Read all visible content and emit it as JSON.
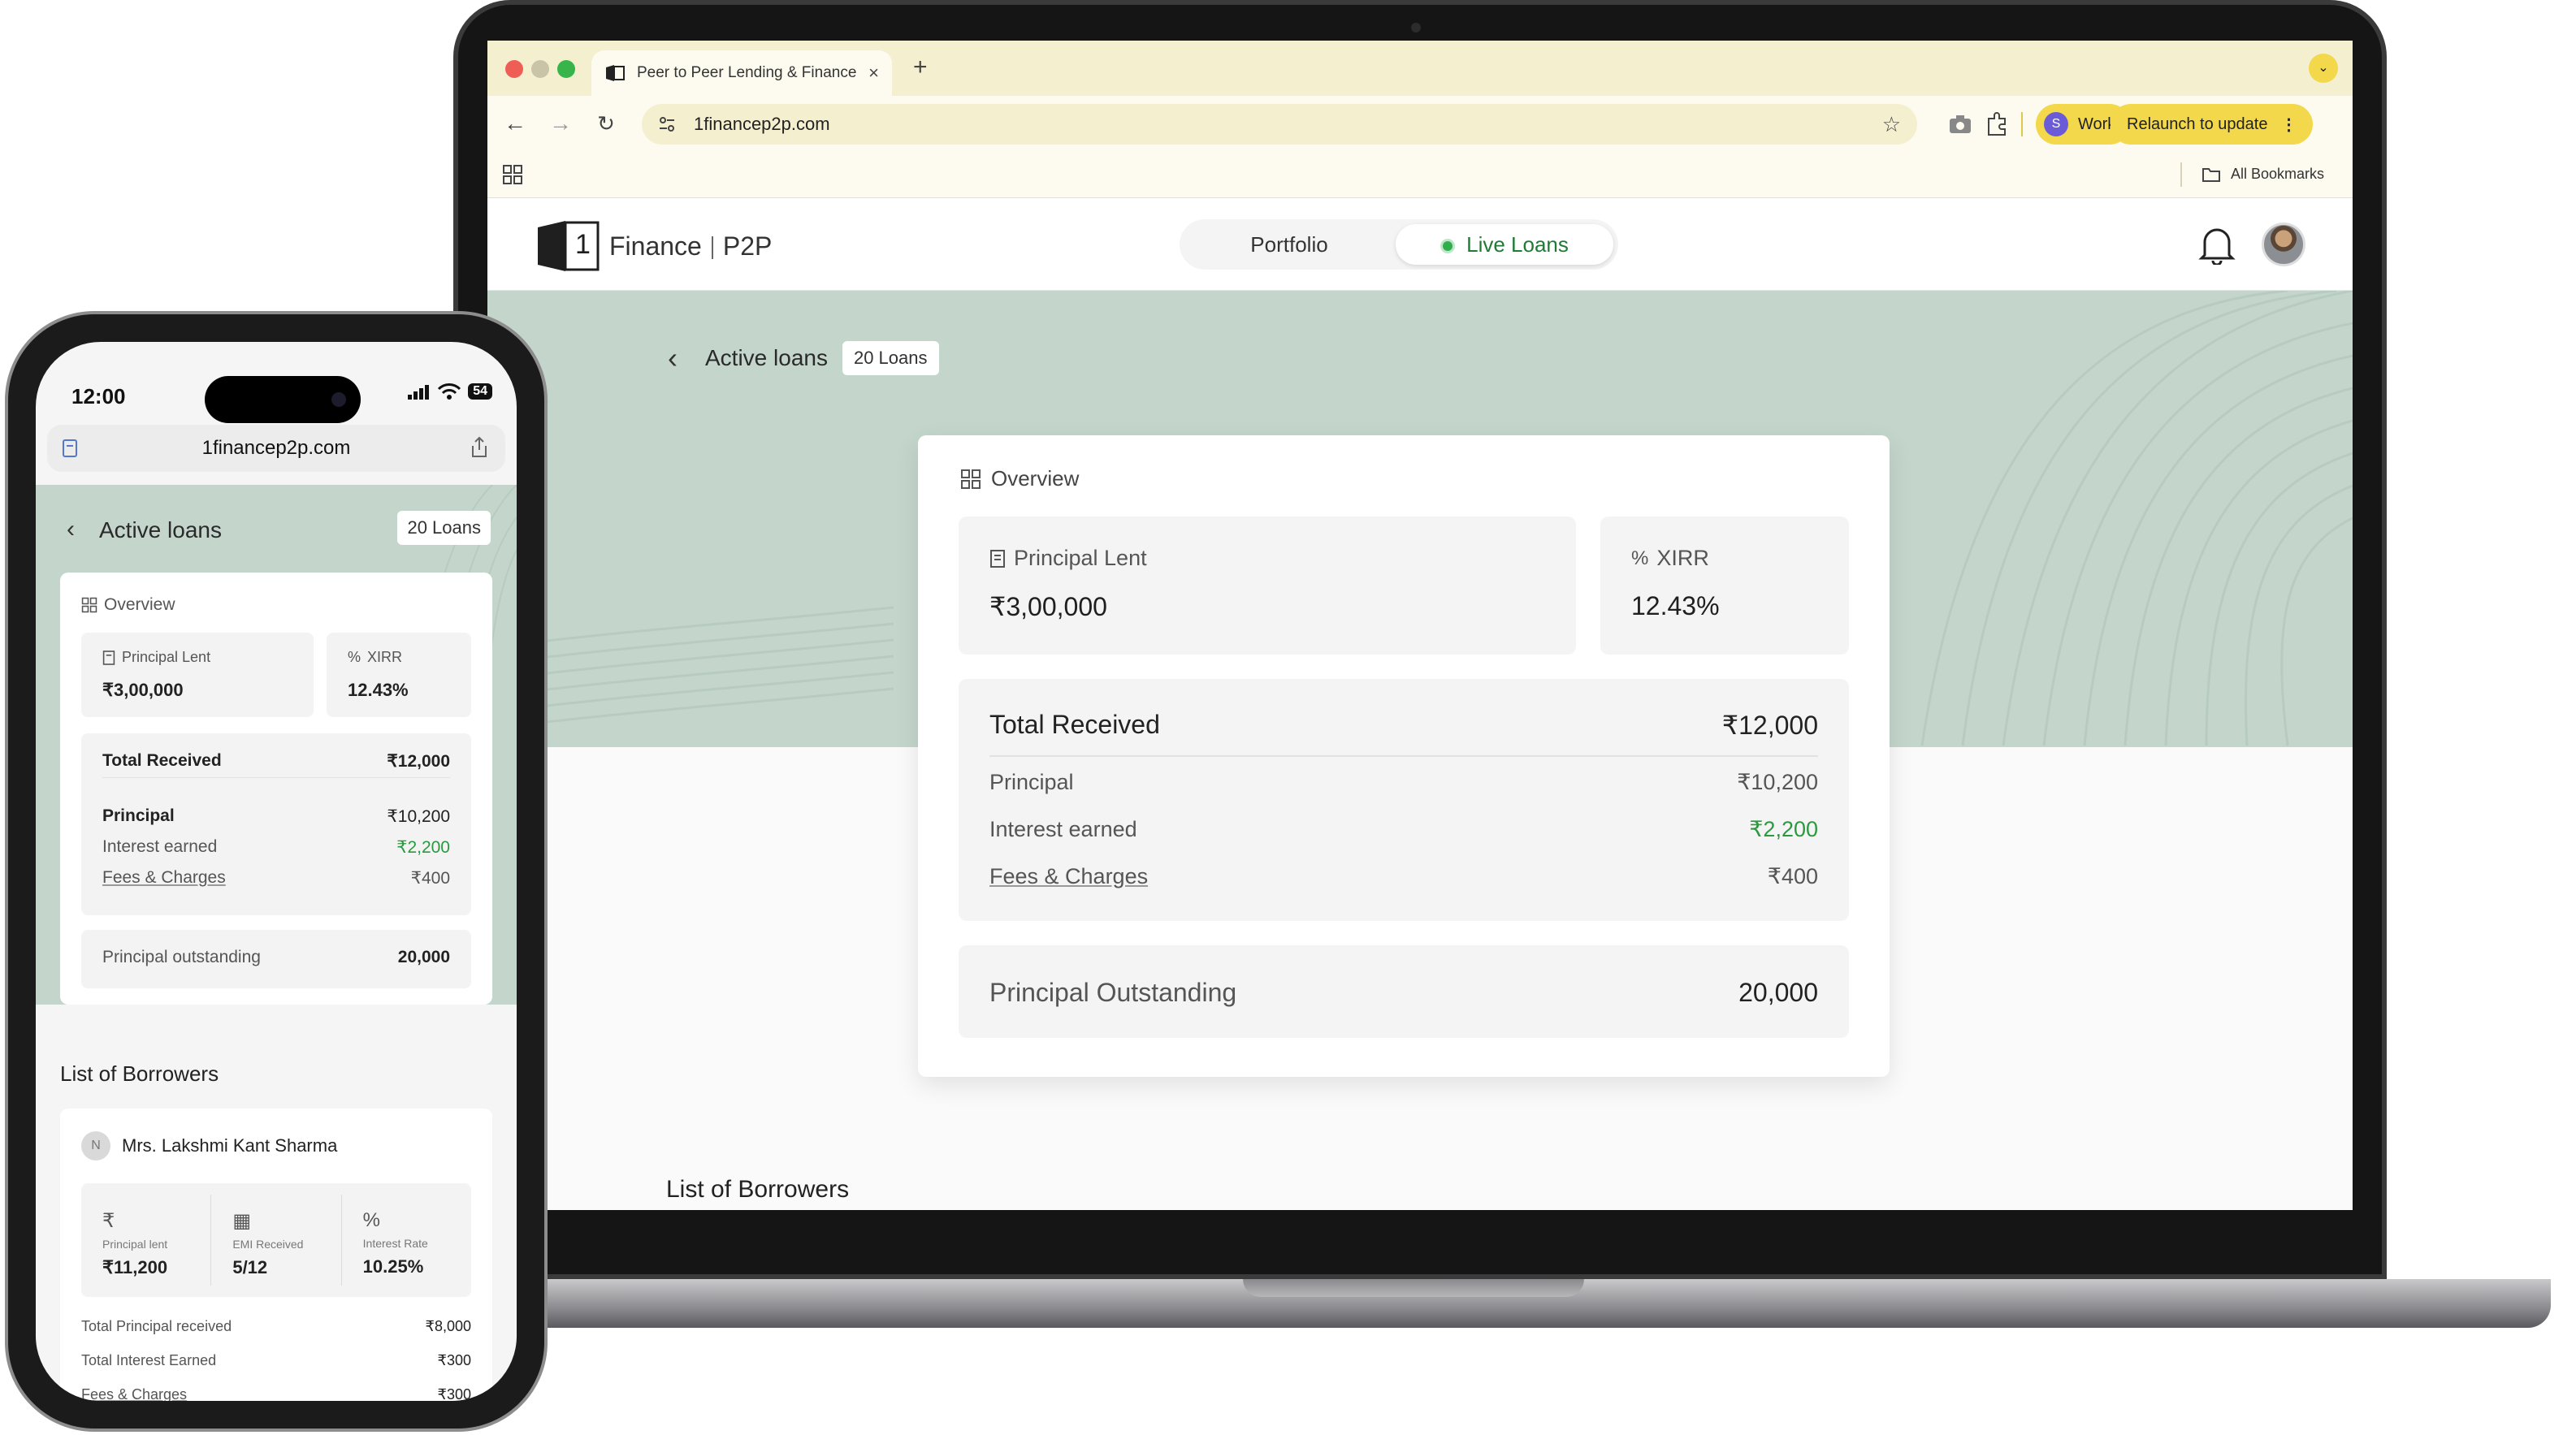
{
  "browser": {
    "tab_title": "Peer to Peer Lending & Finance",
    "new_tab": "+",
    "url": "1financep2p.com",
    "profile_initial": "S",
    "profile_label": "Work",
    "relaunch_label": "Relaunch to update",
    "all_bookmarks": "All Bookmarks"
  },
  "app": {
    "logo_number": "1",
    "logo_name": "Finance",
    "logo_suffix": "P2P",
    "nav_portfolio": "Portfolio",
    "nav_live_loans": "Live Loans",
    "page_title": "Active loans",
    "loan_count": "20 Loans"
  },
  "overview": {
    "title": "Overview",
    "principal_lent_label": "Principal Lent",
    "principal_lent_value": "₹3,00,000",
    "xirr_label": "XIRR",
    "xirr_value": "12.43%",
    "total_received_label": "Total Received",
    "total_received_value": "₹12,000",
    "principal_label": "Principal",
    "principal_value": "₹10,200",
    "interest_label": "Interest earned",
    "interest_value": "₹2,200",
    "fees_label": "Fees & Charges",
    "fees_value": "₹400",
    "outstanding_label": "Principal Outstanding",
    "outstanding_label_mobile": "Principal outstanding",
    "outstanding_value": "20,000"
  },
  "borrowers": {
    "title": "List of Borrowers",
    "items": [
      {
        "initial": "N",
        "name": "Mrs. Lakshmi Kant Sharma",
        "principal_lent_label": "Principal lent",
        "principal_lent_value": "₹11,200",
        "emi_label": "EMI Received",
        "emi_value": "5/12",
        "rate_label": "Interest Rate",
        "rate_value": "10.25%",
        "total_principal_label": "Total Principal received",
        "total_principal_value": "₹8,000",
        "total_interest_label": "Total Interest Earned",
        "total_interest_value": "₹300",
        "fees_label": "Fees & Charges",
        "fees_value": "₹300"
      }
    ]
  },
  "phone": {
    "time": "12:00",
    "battery": "54",
    "url": "1financep2p.com"
  },
  "colors": {
    "hero_bg": "#c4d6cc",
    "accent_green": "#2a9a3f",
    "chrome_yellow": "#f2d84a",
    "chrome_bg": "#fdfbef"
  },
  "icons": [
    "back-arrow-icon",
    "bell-icon",
    "grid-icon",
    "receipt-icon",
    "percent-icon",
    "rupee-icon",
    "calendar-icon",
    "star-icon",
    "camera-icon",
    "extension-icon",
    "folder-icon",
    "share-icon"
  ]
}
